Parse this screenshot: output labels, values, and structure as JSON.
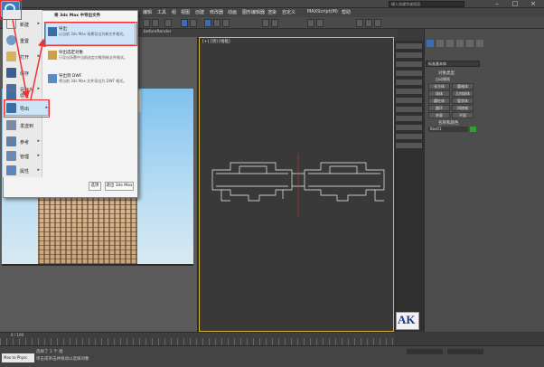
{
  "menubar": {
    "items": [
      "编辑",
      "工具",
      "组",
      "视图",
      "创建",
      "修改器",
      "动画",
      "图形编辑器",
      "渲染",
      "自定义",
      "MAXScript(M)",
      "帮助"
    ]
  },
  "search": {
    "placeholder": "键入关键字或短语"
  },
  "tabs": {
    "active": "beforeRender"
  },
  "viewports": {
    "left_label": "[+] [正交]",
    "center_label": "[+] [顶] [线框]"
  },
  "app_menu": {
    "submenu_title": "将 3ds Max 中导出文件",
    "left_items": [
      {
        "label": "新建",
        "icon": "new-file-icon"
      },
      {
        "label": "重置",
        "icon": "reset-icon"
      },
      {
        "label": "打开",
        "icon": "open-folder-icon"
      },
      {
        "label": "保存",
        "icon": "save-icon"
      },
      {
        "label": "另存为",
        "icon": "save-as-icon"
      },
      {
        "label": "导入",
        "icon": "import-icon"
      },
      {
        "label": "导出",
        "icon": "export-icon"
      },
      {
        "label": "发送到",
        "icon": "send-icon"
      },
      {
        "label": "参考",
        "icon": "reference-icon"
      },
      {
        "label": "管理",
        "icon": "manage-icon"
      },
      {
        "label": "属性",
        "icon": "properties-icon"
      }
    ],
    "sub_items": [
      {
        "title": "导出",
        "desc": "以当前 3ds Max 场景导出为新文件格式。",
        "icon": "export-icon"
      },
      {
        "title": "导出选定对象",
        "desc": "只导出场景中当前选定对象到新文件格式。",
        "icon": "export-selected-icon"
      },
      {
        "title": "导出到 DWF",
        "desc": "将当前 3ds Max 文件导出为 DWF 格式。",
        "icon": "export-dwf-icon"
      }
    ],
    "options_button": "选项",
    "exit_button": "退出 3ds Max"
  },
  "command_panel": {
    "dropdown": "标准基本体",
    "section_object_type": "对象类型",
    "autogrid": "自动栅格",
    "buttons": [
      "长方体",
      "圆锥体",
      "球体",
      "几何球体",
      "圆柱体",
      "管状体",
      "圆环",
      "四棱锥",
      "茶壶",
      "平面"
    ],
    "section_name_color": "名称和颜色",
    "object_name": "Box01"
  },
  "logo": {
    "text": "AK"
  },
  "timeline": {
    "frame": "0 / 100"
  },
  "status": {
    "line1": "选择了 1 个 组",
    "line2": "单击或单击并拖动以选择对象",
    "script_label": "Max to Physc"
  },
  "colors": {
    "accent": "#3b7bbf",
    "annotation": "#e33333",
    "highlight": "#cde3f7"
  }
}
